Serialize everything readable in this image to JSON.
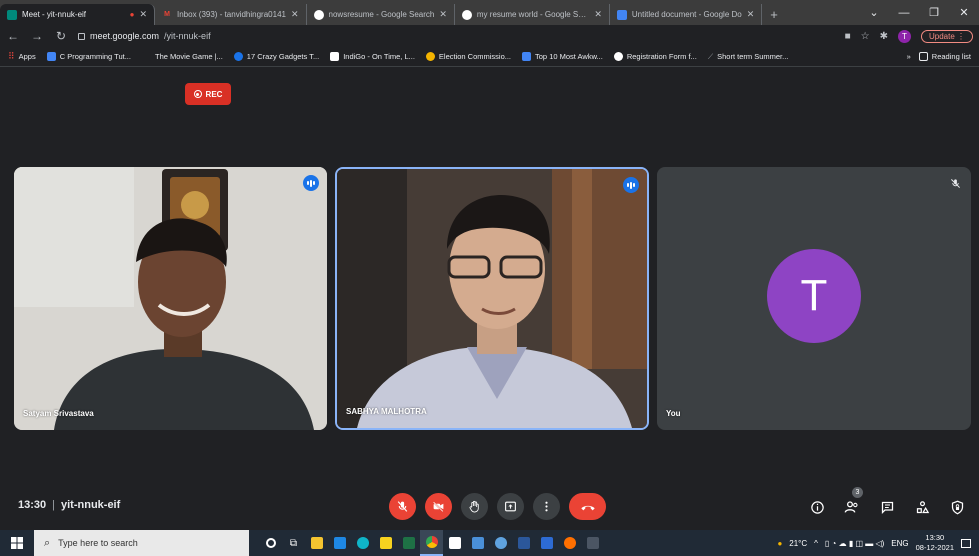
{
  "browser": {
    "tabs": [
      {
        "title": "Meet - yit-nnuk-eif",
        "active": true,
        "fav_color": "#00897b"
      },
      {
        "title": "Inbox (393) - tanvidhingra0141",
        "fav_color": "#ea4335",
        "fav_glyph": "M"
      },
      {
        "title": "nowsresume - Google Search",
        "fav_color": "#ffffff"
      },
      {
        "title": "my resume world - Google Sear",
        "fav_color": "#ffffff"
      },
      {
        "title": "Untitled document - Google Do",
        "fav_color": "#4285f4"
      }
    ],
    "url_host": "meet.google.com",
    "url_path": "/yit-nnuk-eif",
    "update_label": "Update",
    "profile_initial": "T",
    "bookmarks": [
      {
        "label": "Apps",
        "color": "#e8453c"
      },
      {
        "label": "C Programming Tut...",
        "color": "#4285f4"
      },
      {
        "label": "The Movie Game |...",
        "color": "#202124"
      },
      {
        "label": "17 Crazy Gadgets T...",
        "color": "#1a73e8"
      },
      {
        "label": "IndiGo - On Time, L...",
        "color": "#ffffff"
      },
      {
        "label": "Election Commissio...",
        "color": "#f4b400"
      },
      {
        "label": "Top 10 Most Awkw...",
        "color": "#4285f4"
      },
      {
        "label": "Registration Form f...",
        "color": "#ffffff"
      },
      {
        "label": "Short term Summer...",
        "color": "#9aa0a6"
      }
    ],
    "reading_list": "Reading list",
    "more": "»"
  },
  "meet": {
    "rec_label": "REC",
    "participants": [
      {
        "name": "Satyam Srivastava"
      },
      {
        "name": "SABHYA MALHOTRA"
      },
      {
        "name": "You",
        "initial": "T"
      }
    ],
    "time": "13:30",
    "meeting_code": "yit-nnuk-eif",
    "people_count": "3",
    "accent": "#8ab4f8",
    "danger": "#ea4335"
  },
  "taskbar": {
    "search_placeholder": "Type here to search",
    "weather": "21°C",
    "lang": "ENG",
    "time": "13:30",
    "date": "08-12-2021"
  }
}
